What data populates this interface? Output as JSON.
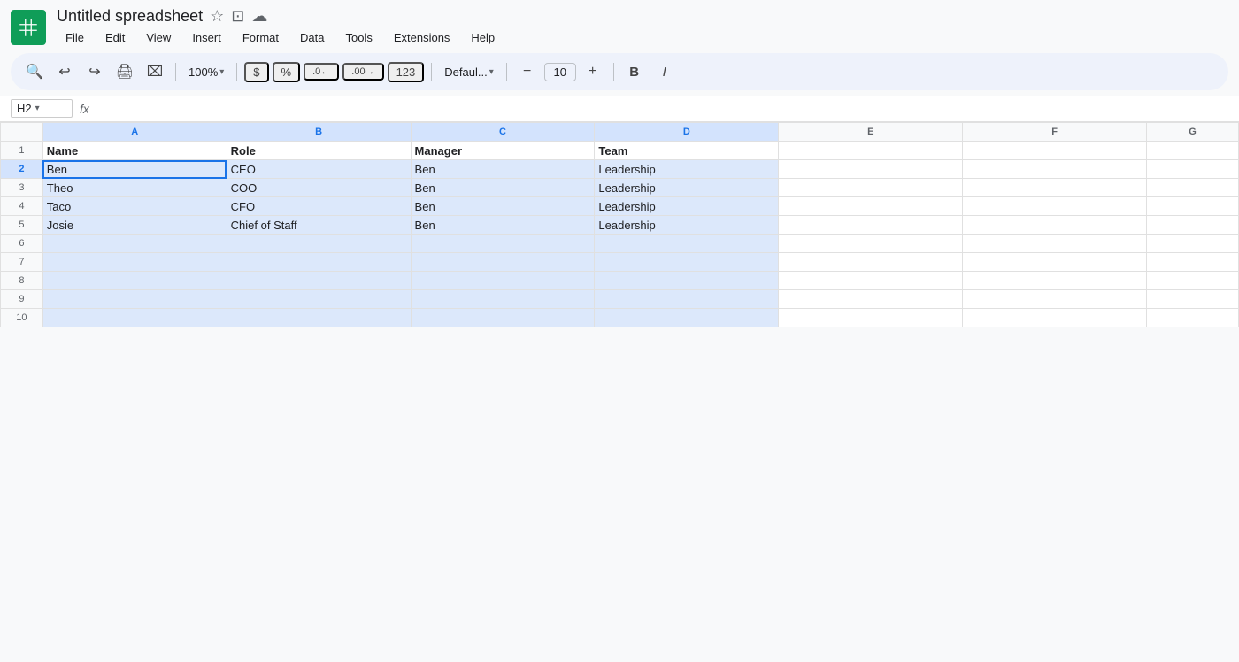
{
  "app": {
    "title": "Untitled spreadsheet",
    "icon_color": "#0f9d58"
  },
  "menu": {
    "items": [
      "File",
      "Edit",
      "View",
      "Insert",
      "Format",
      "Data",
      "Tools",
      "Extensions",
      "Help"
    ]
  },
  "toolbar": {
    "zoom": "100%",
    "font": "Defaul...",
    "font_size": "10",
    "currency_symbol": "$",
    "percent_symbol": "%",
    "decimal_less": ".0←",
    "decimal_more": ".00→",
    "format_number": "123"
  },
  "formula_bar": {
    "cell_ref": "H2",
    "fx_label": "fx"
  },
  "columns": {
    "headers": [
      "",
      "A",
      "B",
      "C",
      "D",
      "E",
      "F",
      "G"
    ]
  },
  "rows": [
    {
      "num": "1",
      "cells": [
        "Name",
        "Role",
        "Manager",
        "Team",
        "",
        "",
        ""
      ],
      "is_header": true
    },
    {
      "num": "2",
      "cells": [
        "Ben",
        "CEO",
        "Ben",
        "Leadership",
        "",
        "",
        ""
      ],
      "selected": true
    },
    {
      "num": "3",
      "cells": [
        "Theo",
        "COO",
        "Ben",
        "Leadership",
        "",
        "",
        ""
      ]
    },
    {
      "num": "4",
      "cells": [
        "Taco",
        "CFO",
        "Ben",
        "Leadership",
        "",
        "",
        ""
      ]
    },
    {
      "num": "5",
      "cells": [
        "Josie",
        "Chief of Staff",
        "Ben",
        "Leadership",
        "",
        "",
        ""
      ]
    },
    {
      "num": "6",
      "cells": [
        "",
        "",
        "",
        "",
        "",
        "",
        ""
      ]
    },
    {
      "num": "7",
      "cells": [
        "",
        "",
        "",
        "",
        "",
        "",
        ""
      ]
    },
    {
      "num": "8",
      "cells": [
        "",
        "",
        "",
        "",
        "",
        "",
        ""
      ]
    },
    {
      "num": "9",
      "cells": [
        "",
        "",
        "",
        "",
        "",
        "",
        ""
      ]
    },
    {
      "num": "10",
      "cells": [
        "",
        "",
        "",
        "",
        "",
        "",
        ""
      ]
    }
  ]
}
